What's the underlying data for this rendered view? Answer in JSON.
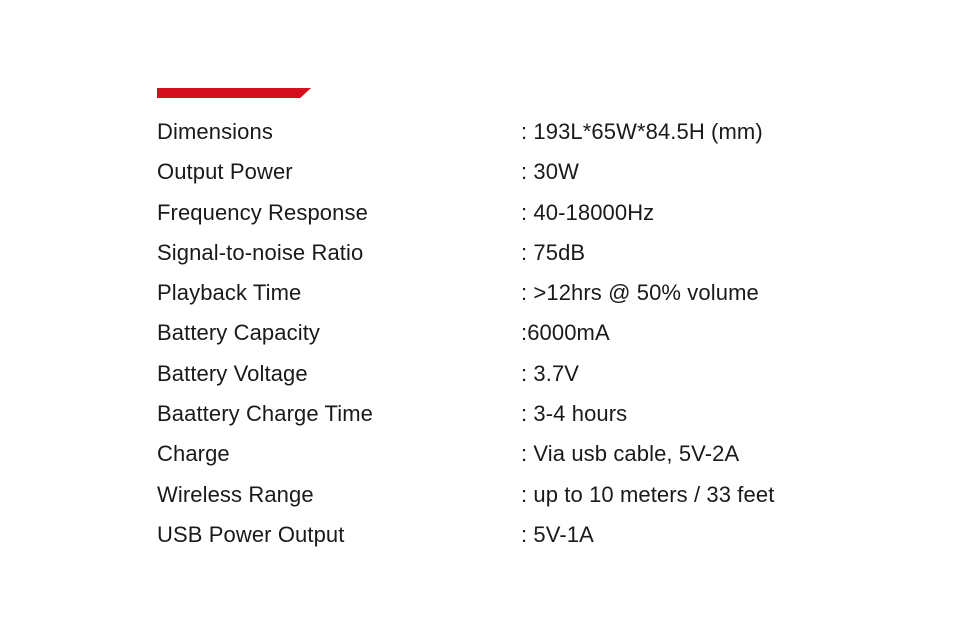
{
  "panel": {
    "background_color": "#ffffff",
    "accent_color": "#d4101e",
    "text_color": "#1a1a1a"
  },
  "accent_bar": {
    "name": "red-accent-bar",
    "color": "#d4101e"
  },
  "spec_list": {
    "rows": [
      {
        "label": "Dimensions",
        "value": ": 193L*65W*84.5H (mm)"
      },
      {
        "label": "Output Power",
        "value": ": 30W"
      },
      {
        "label": "Frequency Response",
        "value": ": 40-18000Hz"
      },
      {
        "label": "Signal-to-noise Ratio",
        "value": ": 75dB"
      },
      {
        "label": "Playback Time",
        "value": ": >12hrs @ 50% volume"
      },
      {
        "label": "Battery Capacity",
        "value": ":6000mA"
      },
      {
        "label": "Battery Voltage",
        "value": ": 3.7V"
      },
      {
        "label": "Baattery Charge Time",
        "value": ": 3-4 hours"
      },
      {
        "label": "Charge",
        "value": ": Via usb cable, 5V-2A"
      },
      {
        "label": "Wireless Range",
        "value": ": up to 10 meters / 33 feet"
      },
      {
        "label": "USB Power Output",
        "value": ": 5V-1A"
      }
    ]
  }
}
